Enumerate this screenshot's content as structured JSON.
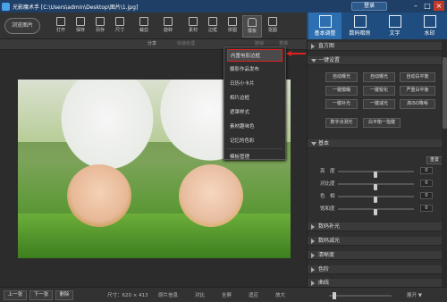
{
  "titlebar": {
    "title": "光影魔术手 [C:\\Users\\admin\\Desktop\\图片\\1.jpg]",
    "login": "登录"
  },
  "window_controls": [
    "–",
    "□",
    "×"
  ],
  "toolbar": {
    "open_label": "浏览图片",
    "tools": [
      {
        "label": "打开",
        "icon": "open-icon"
      },
      {
        "label": "保存",
        "icon": "save-icon"
      },
      {
        "label": "另存",
        "icon": "save-as-icon"
      },
      {
        "label": "尺寸",
        "icon": "resize-icon"
      },
      {
        "label": "裁剪",
        "icon": "crop-icon"
      },
      {
        "label": "旋转",
        "icon": "rotate-icon"
      },
      {
        "label": "素材",
        "icon": "material-icon"
      },
      {
        "label": "边框",
        "icon": "border-icon"
      },
      {
        "label": "拼图",
        "icon": "collage-icon"
      },
      {
        "label": "模板",
        "icon": "template-icon"
      },
      {
        "label": "抠图",
        "icon": "cutout-icon"
      }
    ]
  },
  "right_tabs": [
    {
      "label": "基本调整",
      "icon": "adjust-icon"
    },
    {
      "label": "数码暗房",
      "icon": "darkroom-icon"
    },
    {
      "label": "文字",
      "icon": "text-icon"
    },
    {
      "label": "水印",
      "icon": "watermark-icon"
    }
  ],
  "subbar": {
    "share": "分享",
    "fast_process": "快速处理",
    "undo": "撤销",
    "redo": "重做"
  },
  "template_menu": {
    "items": [
      "内置电影边框",
      "摄影作品发布",
      "日历小卡片",
      "相片边框",
      "遮罩样式",
      "素材趣味色",
      "记忆的色彩",
      "模板管理"
    ]
  },
  "panel": {
    "histogram": "直方图",
    "one_click": "一键设置",
    "buttons": [
      "自动曝光",
      "自动曝光",
      "自动白平衡",
      "一键模糊",
      "一键锐化",
      "严重白平衡",
      "一键补光",
      "一键减光",
      "高ISO降噪",
      "数字点测光",
      "白平衡一指键"
    ],
    "basic": "基本",
    "reset": "重置",
    "sliders": [
      {
        "label": "亮　度",
        "value": "0"
      },
      {
        "label": "对比度",
        "value": "0"
      },
      {
        "label": "色　相",
        "value": "0"
      },
      {
        "label": "饱和度",
        "value": "0"
      }
    ],
    "collapsed": [
      "数码补光",
      "数码减光",
      "清晰度",
      "色阶",
      "曲线"
    ]
  },
  "statusbar": {
    "prev": "上一张",
    "next": "下一张",
    "delete": "删除",
    "size": "尺寸：620 × 413",
    "original": "原片信息",
    "compare": "对比",
    "fit": "全屏",
    "actual": "适应",
    "zoom_in": "放大",
    "expand": "展开 ▼"
  },
  "colors": {
    "accent": "#1f4d80",
    "highlight": "#e02020"
  }
}
